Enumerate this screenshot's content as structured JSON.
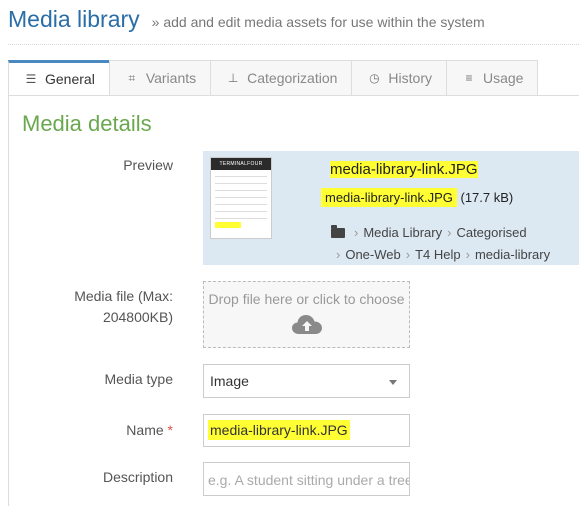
{
  "header": {
    "title": "Media library",
    "subtitle": "» add and edit media assets for use within the system"
  },
  "tabs": [
    {
      "label": "General",
      "icon": "sliders-icon",
      "active": true
    },
    {
      "label": "Variants",
      "icon": "crop-icon",
      "active": false
    },
    {
      "label": "Categorization",
      "icon": "sitemap-icon",
      "active": false
    },
    {
      "label": "History",
      "icon": "clock-icon",
      "active": false
    },
    {
      "label": "Usage",
      "icon": "list-icon",
      "active": false
    }
  ],
  "section": {
    "title": "Media details"
  },
  "preview": {
    "label": "Preview",
    "thumbnail_brand": "TERMINALFOUR",
    "filename": "media-library-link.JPG",
    "file_link": "media-library-link.JPG",
    "file_size": "(17.7 kB)",
    "breadcrumb": [
      "Media Library",
      "Categorised",
      "One-Web",
      "T4 Help",
      "media-library"
    ]
  },
  "media_file": {
    "label": "Media file (Max: 204800KB)",
    "dropzone_text": "Drop file here or click to choose"
  },
  "media_type": {
    "label": "Media type",
    "value": "Image"
  },
  "name": {
    "label": "Name",
    "required_mark": "*",
    "value": "media-library-link.JPG"
  },
  "description": {
    "label": "Description",
    "placeholder": "e.g. A student sitting under a tree"
  },
  "colors": {
    "title_blue": "#2a6ea8",
    "section_green": "#6aa84f",
    "highlight": "#ffff33",
    "preview_bg": "#dce9f3"
  }
}
